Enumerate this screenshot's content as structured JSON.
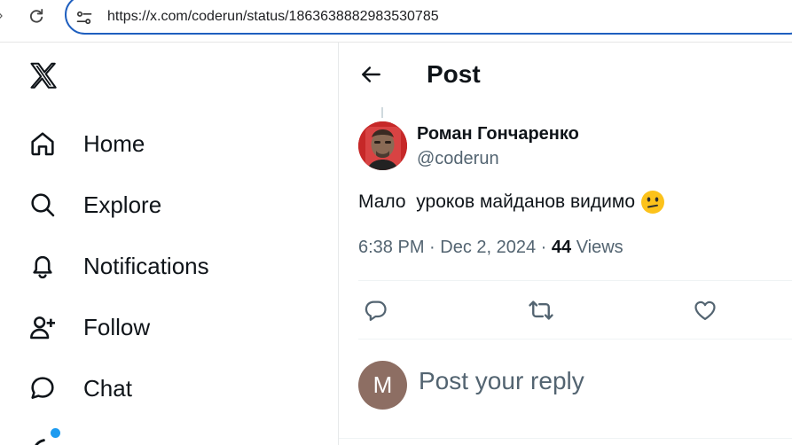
{
  "browser": {
    "url": "https://x.com/coderun/status/1863638882983530785"
  },
  "sidebar": {
    "items": [
      {
        "label": "Home",
        "icon": "home-icon"
      },
      {
        "label": "Explore",
        "icon": "search-icon"
      },
      {
        "label": "Notifications",
        "icon": "bell-icon"
      },
      {
        "label": "Follow",
        "icon": "person-add-icon"
      },
      {
        "label": "Chat",
        "icon": "chat-icon"
      }
    ],
    "notification_dot_color": "#1d9bf0"
  },
  "post": {
    "header_title": "Post",
    "author": {
      "display_name": "Роман Гончаренко",
      "handle": "@coderun"
    },
    "text": "Мало  уроков майданов видимо",
    "timestamp": "6:38 PM · Dec 2, 2024",
    "separator": " · ",
    "views_count": "44",
    "views_label": " Views"
  },
  "reply": {
    "avatar_letter": "M",
    "placeholder": "Post your reply"
  }
}
